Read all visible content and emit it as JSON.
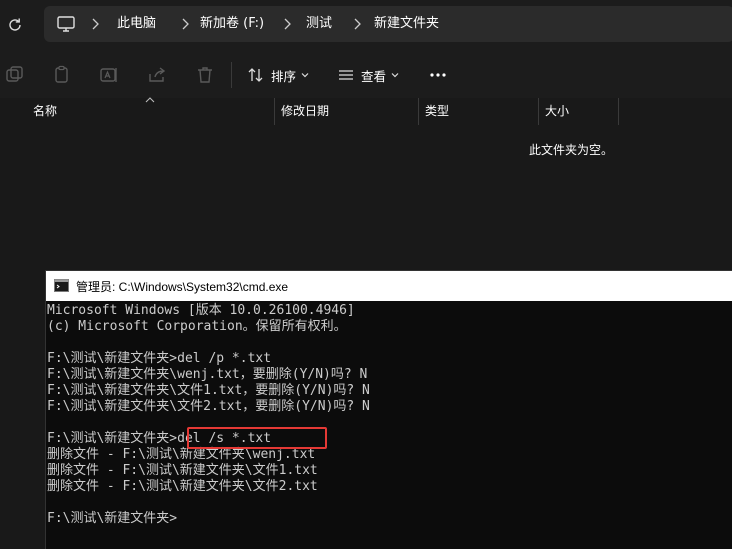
{
  "address": {
    "breadcrumbs": [
      "此电脑",
      "新加卷 (F:)",
      "测试",
      "新建文件夹"
    ]
  },
  "toolbar": {
    "sort_label": "排序",
    "view_label": "查看"
  },
  "columns": [
    "名称",
    "修改日期",
    "类型",
    "大小"
  ],
  "empty_message": "此文件夹为空。",
  "cmd": {
    "title": "管理员: C:\\Windows\\System32\\cmd.exe",
    "lines": [
      "Microsoft Windows [版本 10.0.26100.4946]",
      "(c) Microsoft Corporation。保留所有权利。",
      "",
      "F:\\测试\\新建文件夹>del /p *.txt",
      "F:\\测试\\新建文件夹\\wenj.txt，要删除(Y/N)吗? N",
      "F:\\测试\\新建文件夹\\文件1.txt，要删除(Y/N)吗? N",
      "F:\\测试\\新建文件夹\\文件2.txt，要删除(Y/N)吗? N",
      "",
      "F:\\测试\\新建文件夹>del /s *.txt",
      "删除文件 - F:\\测试\\新建文件夹\\wenj.txt",
      "删除文件 - F:\\测试\\新建文件夹\\文件1.txt",
      "删除文件 - F:\\测试\\新建文件夹\\文件2.txt",
      "",
      "F:\\测试\\新建文件夹>"
    ]
  },
  "colors": {
    "explorer_bg": "#191919",
    "console_bg": "#0c0c0c",
    "console_text": "#cccccc",
    "highlight_border": "#e53935"
  }
}
